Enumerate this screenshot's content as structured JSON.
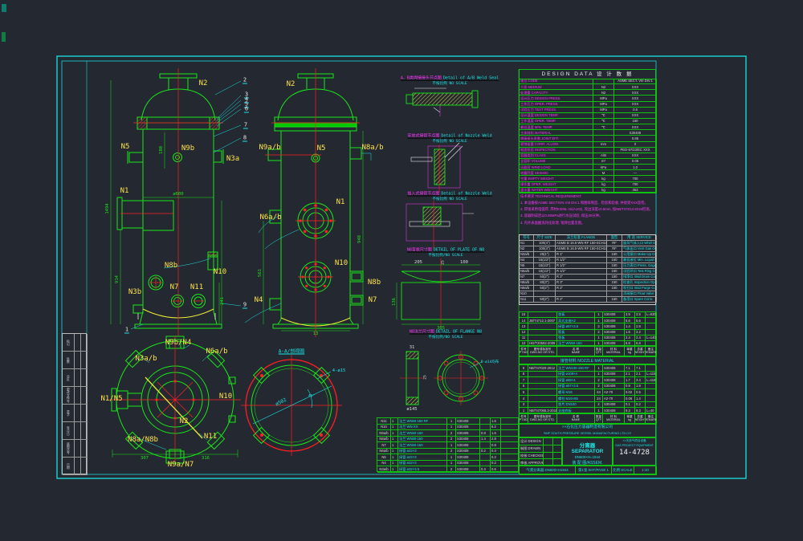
{
  "drawing_no": "14-4728",
  "labels": {
    "v1_n2": "N2",
    "v1_n5": "N5",
    "v1_n9b": "N9b",
    "v1_n3a": "N3a",
    "v1_n1": "N1",
    "v1_n8b": "N8b",
    "v1_n10": "N10",
    "v1_n3b": "N3b",
    "v1_n7": "N7",
    "v1_n11": "N11",
    "v2_n2": "N2",
    "v2_n9ab": "N9a/b",
    "v2_n5": "N5",
    "v2_n8ab": "N8a/b",
    "v2_n1": "N1",
    "v2_n6ab": "N6a/b",
    "v2_n10": "N10",
    "v2_n8b": "N8b",
    "v2_n4": "N4",
    "v2_n7": "N7",
    "p_n9bn4": "N9b/N4",
    "p_n6ab": "N6a/b",
    "p_n3ab": "N3a/b",
    "p_n1n5": "N1/N5",
    "p_n10": "N10",
    "p_n2": "N2",
    "p_n8ab": "N8a/N8b",
    "p_n11": "N11",
    "p_n9an7": "N9a/N7",
    "bal1": "1",
    "bal2": "2",
    "bal3": "3",
    "bal4": "4",
    "bal5": "5",
    "bal6": "6",
    "bal7": "7",
    "bal8": "8",
    "bal9": "9",
    "aa_title": "A-A/剖视图"
  },
  "dims": {
    "d1494": "1494",
    "d914": "914",
    "d600": "ø600",
    "d180": "180",
    "d241": "241",
    "d948": "948",
    "d561": "561",
    "d13": "13",
    "d307": "307",
    "d316": "316",
    "d502": "ø502",
    "d4o15": "4-ø15",
    "d45": "45°",
    "d205": "205",
    "d25": "25",
    "d100": "100",
    "d136": "136",
    "d305": "305",
    "d31": "31",
    "d25b": "25",
    "d145": "ø145",
    "bolt8": "8-ø14均布"
  },
  "details": {
    "ns": "不按比例 NO SCALE",
    "ns2": "不按比例/NO SCALE",
    "d1_zh": "A、B类焊接接头节点图",
    "d1_en": "Detail of A/B Weld Seal",
    "d2_zh": "安放式接管节点图",
    "d2_en": "Detail of Nozzle Weld",
    "d3_zh": "插入式接管节点图",
    "d3_en": "Detail of Nozzle Weld",
    "d4_zh": "N8盲板尺寸图",
    "d4_en": "DETAIL OF PLATE OF N8",
    "d5_zh": "N8法兰尺寸图",
    "d5_en": "DETAIL OF FLANGE N8"
  },
  "design_table": {
    "title": "DESIGN DATA  设 计 数 据",
    "rows": [
      [
        "规范 CODE",
        "",
        "ASME SECT. VIII DIV.1"
      ],
      [
        "介质 MEDIUM",
        "N2",
        "XXX"
      ],
      [
        "处理量 CAPACITY",
        "N2",
        "XXX"
      ],
      [
        "设计压力 DESIGN PRESS.",
        "MPa",
        "XXX"
      ],
      [
        "工作压力 OPER. PRESS.",
        "MPa",
        "XXX"
      ],
      [
        "试验压力 TEST PRESS.",
        "MPa",
        "0.6"
      ],
      [
        "设计温度 DESIGN TEMP.",
        "℃",
        "XXX"
      ],
      [
        "工作温度 OPER. TEMP.",
        "℃",
        "150"
      ],
      [
        "最低温度 MIN. TEMP.",
        "℃",
        "XXX"
      ],
      [
        "主体材料 MATERIAL",
        "",
        "S30408"
      ],
      [
        "焊接接头系数 JOINT EFF.",
        "",
        "0.85"
      ],
      [
        "腐蚀裕量 CORR. ALLOW.",
        "mm",
        "0"
      ],
      [
        "制造检验 INSPECTION",
        "",
        "PED-97/23/EC  XXX"
      ],
      [
        "容器类别 CLASS",
        "A/B",
        "XXX"
      ],
      [
        "全容积 VOLUME",
        "m³",
        "0.05"
      ],
      [
        "风载荷 WIND LOAD",
        "kPa",
        "1.0"
      ],
      [
        "地震烈度 SEISMIC",
        "M",
        "—"
      ],
      [
        "空重 EMPTY WEIGHT",
        "kg",
        "700"
      ],
      [
        "操作重 OPER. WEIGHT",
        "kg",
        "700"
      ],
      [
        "盛水重 WATER WEIGHT",
        "kg",
        "353"
      ]
    ]
  },
  "notes": {
    "lines": [
      "技术要求 TECHNICAL REQUIREMENT:",
      "1. 本设备按ASME SECTION VIII DIV.1 和图样制造、检验和验收, 并接受XXX监检。",
      "2. 焊接采用电弧焊, 焊材E308L-16(A102), 咬边深度≤0.5mm, 按NB/T47013-2015检测。",
      "3. 容器制成后以0.85MPa进行水压试验, 保压30分钟。",
      "4. 内外表面酸洗钝化处理, 铭牌位置见图。"
    ]
  },
  "nozzle_table": {
    "header": [
      "符号",
      "尺寸 SIZE",
      "法兰标准 FLANGE",
      "面型",
      "用 途 SERVICE"
    ],
    "rows": [
      [
        "N1",
        "100(4\")",
        "ASME B 16.5-WN RF 150-SCH10S",
        "RF",
        "旋风气体入口 Whirl Gas Inlet"
      ],
      [
        "N2",
        "100(4\")",
        "ASME B 16.5-WN RF 150-SCH10S",
        "RF",
        "气体出口 Vent Gas Outlet"
      ],
      [
        "N3a/b",
        "25(1\")",
        "R 1\"",
        "150",
        "公用接口 Make-Up Conn."
      ],
      [
        "N4",
        "15(1/2\")",
        "R 1/2\"",
        "150",
        "最低液位 Min. Liquid Level"
      ],
      [
        "N5",
        "15(1/2\")",
        "R 1/2\"",
        "150",
        "压力表口 Press. Gage Conn."
      ],
      [
        "N6a/b",
        "15(1/2\")",
        "R 1/2\"",
        "150",
        "试验环口 Test Ring Conn."
      ],
      [
        "N7",
        "50(2\")",
        "R 2\"",
        "150",
        "排净口 Skid Drain Conn."
      ],
      [
        "N8a/b",
        "80(3\")",
        "R 3\"",
        "150",
        "检查孔 Inspection Opening"
      ],
      [
        "N9a/b",
        "50(2\")",
        "R 2\"",
        "150",
        "吹扫口 Skid Purge Conn."
      ],
      [
        "N10",
        "",
        "",
        "",
        "浮阀接口 Float Valve Conn."
      ],
      [
        "N11",
        "50(2\")",
        "R 2\"",
        "150",
        "备用口 Spare Conn."
      ]
    ]
  },
  "bom_header": {
    "rows": [
      [
        "件号\nPT.NO",
        "图号或标准号\nDWG.NO OR STD.",
        "名 称\nNAME",
        "数量\nQTY",
        "材 料\nMATERIAL",
        "单重\nkg",
        "总重\nWEIGHT",
        "备注\nREMARK"
      ]
    ]
  },
  "bom_section_title": "接管材料 NOZZLE MATERIAL",
  "bom_top": {
    "rows": [
      [
        "15",
        "",
        "垫板",
        "1",
        "S30408",
        "3.5",
        "3.5",
        "L=630"
      ],
      [
        "14",
        "JB/T4712.1-2007",
        "耳式支座A2",
        "1",
        "S30408",
        "5.6",
        "5.6",
        ""
      ],
      [
        "13",
        "",
        "接管 ø57×3.5",
        "2",
        "S30408",
        "1.4",
        "2.8",
        ""
      ],
      [
        "12",
        "",
        "筋板",
        "2",
        "S30408",
        "1.6",
        "3.2",
        ""
      ],
      [
        "11",
        "",
        "垫板",
        "1",
        "S30408",
        "2.4",
        "2.4",
        "L=140"
      ],
      [
        "10",
        "HG/T20592-2009",
        "法兰 WN50-150",
        "1",
        "S30408",
        "6.8",
        "6.8",
        ""
      ]
    ]
  },
  "bom_mid": {
    "rows": [
      [
        "9",
        "NB/T47020-2012",
        "法兰 WN100-150 RF",
        "1",
        "S30408",
        "7.1",
        "7.1",
        ""
      ],
      [
        "8",
        "",
        "接管 ø108×4",
        "1",
        "S30408",
        "2.1",
        "2.1",
        "L=115"
      ],
      [
        "7",
        "",
        "接管 ø89×4",
        "2",
        "S30408",
        "1.7",
        "3.4",
        "L=118"
      ],
      [
        "6",
        "",
        "接管 ø57×3.5",
        "2",
        "S30408",
        "0.9",
        "1.8",
        ""
      ],
      [
        "5",
        "",
        "螺母 M16",
        "24",
        "A2-70",
        "0.02",
        "0.5",
        ""
      ],
      [
        "4",
        "",
        "螺柱 M16×65",
        "24",
        "A2-70",
        "0.06",
        "1.4",
        ""
      ],
      [
        "3",
        "",
        "垫片 DN100",
        "2",
        "S30408",
        "0.1",
        "0.2",
        ""
      ],
      [
        "1",
        "NB/T47065.3-2018",
        "支座底板",
        "1",
        "S30408",
        "9.3",
        "9.3",
        "L=40"
      ]
    ]
  },
  "bt_table": {
    "rows": [
      [
        "N11",
        "1",
        "法兰 WN50-150 RF",
        "1",
        "S30408",
        "",
        "1.6",
        ""
      ],
      [
        "N10",
        "1",
        "法兰 WN-XX",
        "1",
        "S30408",
        "",
        "6.2",
        ""
      ],
      [
        "N9a/b",
        "1",
        "法兰 WN50-150",
        "2",
        "S30408",
        "0.8",
        "1.6",
        ""
      ],
      [
        "N8a/b",
        "1",
        "法兰 WN80-150",
        "2",
        "S30408",
        "1.4",
        "2.8",
        ""
      ],
      [
        "N7",
        "1",
        "法兰 WN50-150",
        "1",
        "S30408",
        "",
        "0.8",
        ""
      ],
      [
        "N6a/b",
        "1",
        "接管 ø22×3",
        "2",
        "S30408",
        "0.2",
        "0.4",
        ""
      ],
      [
        "N5",
        "1",
        "接管 ø22×3",
        "1",
        "S30408",
        "",
        "0.2",
        ""
      ],
      [
        "N4",
        "1",
        "接管 ø22×3",
        "1",
        "S30408",
        "",
        "0.2",
        ""
      ],
      [
        "N3a/b",
        "1",
        "接管 ø32×3.5",
        "2",
        "S30408",
        "0.3",
        "0.6",
        ""
      ]
    ]
  },
  "titleblock": {
    "company_zh": "××石化压力容器制造有限公司",
    "company_en": "SMP SOUTH PRESSURE VESSEL MANUFACTURING LTD.CO",
    "sign_rows": [
      [
        "设计 DESIGN",
        "",
        ""
      ],
      [
        "制图 DRAWN",
        "",
        ""
      ],
      [
        "校核 CHECKED",
        "",
        ""
      ],
      [
        "审核 APPROVED",
        "",
        ""
      ]
    ],
    "title_zh": "分离器 SEPARATOR",
    "size_line": "DN600×H=1944",
    "type_line": "装 配 图/ASSEM.",
    "stamp_line1": "××天然气项目设备",
    "stamp_line2": "GAS PROJECT EQUIPMENT",
    "dwg_no": "14-4728",
    "foot": [
      "气液分离器 DN600×H1944",
      "第1张 SHT/PAGE 1",
      "比例 SCALE",
      "1:10"
    ]
  },
  "revision_strip": {
    "rows": [
      [
        "标记",
        "",
        ""
      ],
      [
        "处数",
        "",
        ""
      ],
      [
        "分区",
        "",
        ""
      ],
      [
        "更改文件号",
        "",
        ""
      ],
      [
        "签字",
        "",
        ""
      ],
      [
        "年月日",
        "",
        ""
      ],
      [
        "底图总号",
        "",
        ""
      ],
      [
        "日期",
        "",
        ""
      ]
    ]
  }
}
